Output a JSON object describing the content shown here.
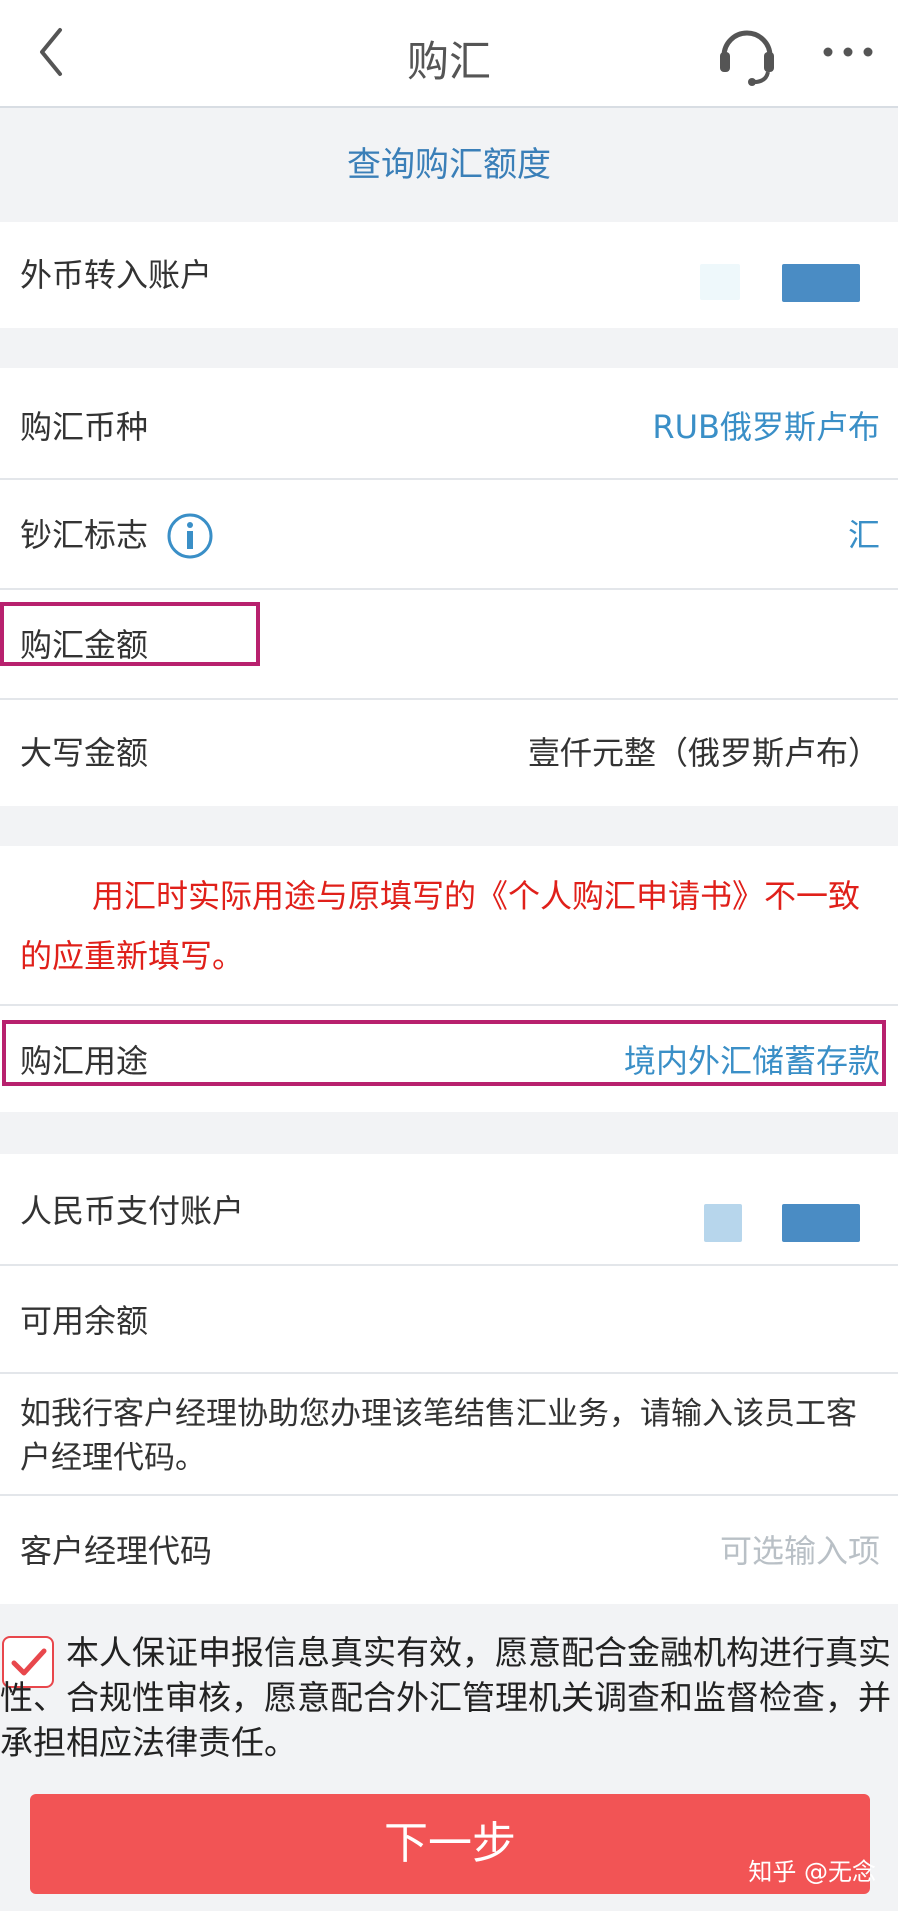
{
  "header": {
    "title": "购汇",
    "back_icon": "chevron-left-icon",
    "support_icon": "headset-icon",
    "more_icon": "more-dots-icon"
  },
  "query_link": "查询购汇额度",
  "rows": {
    "fx_account": {
      "label": "外币转入账户",
      "value": ""
    },
    "currency": {
      "label": "购汇币种",
      "value": "RUB俄罗斯卢布"
    },
    "cash_flag": {
      "label": "钞汇标志",
      "value": "汇"
    },
    "amount": {
      "label": "购汇金额",
      "value": ""
    },
    "amount_words": {
      "label": "大写金额",
      "value": "壹仟元整（俄罗斯卢布）"
    },
    "purpose": {
      "label": "购汇用途",
      "value": "境内外汇储蓄存款"
    },
    "cny_account": {
      "label": "人民币支付账户",
      "value": ""
    },
    "available": {
      "label": "可用余额",
      "value": ""
    },
    "manager_code": {
      "label": "客户经理代码",
      "placeholder": "可选输入项"
    }
  },
  "notice": "用汇时实际用途与原填写的《个人购汇申请书》不一致的应重新填写。",
  "help_text": "如我行客户经理协助您办理该笔结售汇业务，请输入该员工客户经理代码。",
  "agreement": {
    "checked": true,
    "text": "本人保证申报信息真实有效，愿意配合金融机构进行真实性、合规性审核，愿意配合外汇管理机关调查和监督检查，并承担相应法律责任。"
  },
  "next_button": "下一步",
  "watermark": "知乎 @无念",
  "colors": {
    "accent_blue": "#3a8fc7",
    "notice_red": "#e0201a",
    "button_red": "#f25455",
    "highlight_magenta": "#b8216e"
  }
}
